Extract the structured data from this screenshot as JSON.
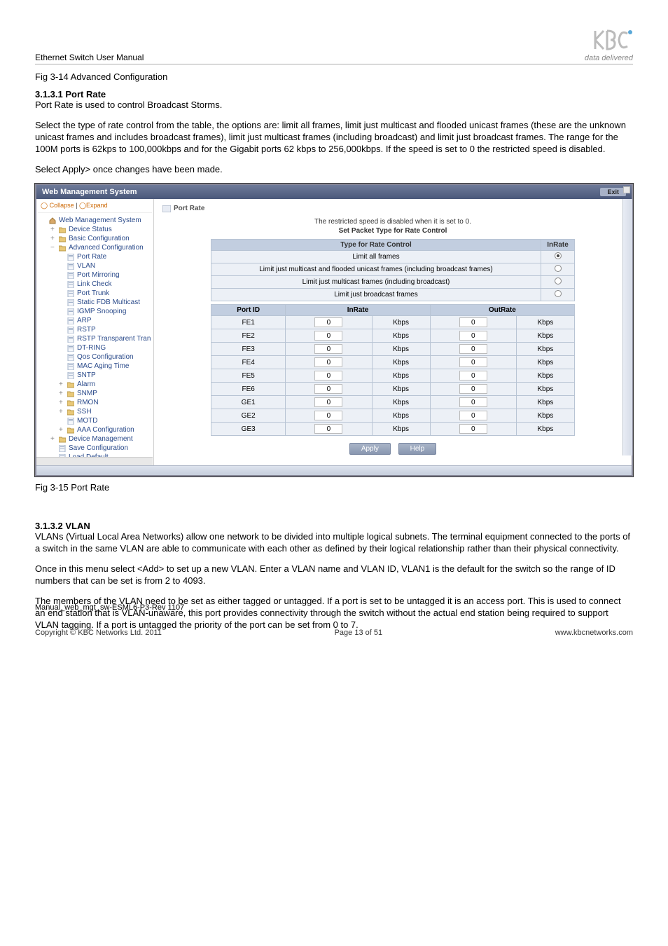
{
  "header": {
    "title": "Ethernet Switch User Manual",
    "logo_tagline": "data delivered"
  },
  "captions": {
    "fig_top": "Fig 3-14 Advanced Configuration",
    "fig_mid": "Fig 3-15 Port Rate"
  },
  "sections": {
    "s1_head": "3.1.3.1 Port Rate",
    "s1_p1": "Port Rate is used to control Broadcast Storms.",
    "s1_p2": "Select the type of rate control from the table, the options are: limit all frames, limit just multicast and flooded unicast frames (these are the unknown unicast frames and includes broadcast frames), limit just multicast frames (including broadcast) and limit just broadcast frames. The range for the 100M ports is 62kps to 100,000kbps and for the Gigabit ports 62 kbps to 256,000kbps. If the speed is set to 0 the restricted speed is disabled.",
    "s1_p3": "Select  Apply> once changes have been made.",
    "s2_head": "3.1.3.2 VLAN",
    "s2_p1": "VLANs (Virtual Local Area Networks) allow one network to be divided into multiple logical subnets. The terminal equipment connected to the ports of a switch in the same VLAN are able to communicate with each other as defined by their logical relationship rather than their physical connectivity.",
    "s2_p2": "Once in this menu select <Add> to set up a new VLAN. Enter a VLAN name and VLAN ID, VLAN1 is the default for the switch so the range of ID numbers that can be set is from 2 to 4093.",
    "s2_p3": "The members of the VLAN need to be set as either tagged or untagged. If a port is set to be untagged it is an access port. This is used to connect an end station that is VLAN-unaware, this port provides connectivity through the switch without the actual end station being required to support VLAN tagging. If a port is untagged the priority of the port can be set from 0 to 7."
  },
  "app": {
    "titlebar": "Web Management System",
    "exit": "Exit",
    "tree_collapse": "Collapse",
    "tree_expand": "Expand",
    "breadcrumb": "Port Rate",
    "tree": [
      {
        "label": "Web Management System",
        "level": 0,
        "icon": "home"
      },
      {
        "label": "Device Status",
        "level": 1,
        "icon": "folder"
      },
      {
        "label": "Basic Configuration",
        "level": 1,
        "icon": "folder"
      },
      {
        "label": "Advanced Configuration",
        "level": 1,
        "icon": "folder-open"
      },
      {
        "label": "Port Rate",
        "level": 2,
        "icon": "page"
      },
      {
        "label": "VLAN",
        "level": 2,
        "icon": "page"
      },
      {
        "label": "Port Mirroring",
        "level": 2,
        "icon": "page"
      },
      {
        "label": "Link Check",
        "level": 2,
        "icon": "page"
      },
      {
        "label": "Port Trunk",
        "level": 2,
        "icon": "page"
      },
      {
        "label": "Static FDB Multicast",
        "level": 2,
        "icon": "page"
      },
      {
        "label": "IGMP Snooping",
        "level": 2,
        "icon": "page"
      },
      {
        "label": "ARP",
        "level": 2,
        "icon": "page"
      },
      {
        "label": "RSTP",
        "level": 2,
        "icon": "page"
      },
      {
        "label": "RSTP Transparent Tran",
        "level": 2,
        "icon": "page"
      },
      {
        "label": "DT-RING",
        "level": 2,
        "icon": "page"
      },
      {
        "label": "Qos Configuration",
        "level": 2,
        "icon": "page"
      },
      {
        "label": "MAC Aging Time",
        "level": 2,
        "icon": "page"
      },
      {
        "label": "SNTP",
        "level": 2,
        "icon": "page"
      },
      {
        "label": "Alarm",
        "level": 2,
        "icon": "folder"
      },
      {
        "label": "SNMP",
        "level": 2,
        "icon": "folder"
      },
      {
        "label": "RMON",
        "level": 2,
        "icon": "folder"
      },
      {
        "label": "SSH",
        "level": 2,
        "icon": "folder"
      },
      {
        "label": "MOTD",
        "level": 2,
        "icon": "page"
      },
      {
        "label": "AAA Configuration",
        "level": 2,
        "icon": "folder"
      },
      {
        "label": "Device Management",
        "level": 1,
        "icon": "folder"
      },
      {
        "label": "Save Configuration",
        "level": 1,
        "icon": "page"
      },
      {
        "label": "Load Default",
        "level": 1,
        "icon": "page"
      }
    ],
    "restrict_line": "The restricted speed is disabled when it is set to 0.",
    "restrict_sub": "Set Packet Type for Rate Control",
    "type_table": {
      "h_type": "Type for Rate Control",
      "h_inrate": "InRate",
      "rows": [
        {
          "label": "Limit all frames",
          "sel": true
        },
        {
          "label": "Limit just multicast and flooded unicast frames (including broadcast frames)",
          "sel": false
        },
        {
          "label": "Limit just multicast frames (including broadcast)",
          "sel": false
        },
        {
          "label": "Limit just broadcast frames",
          "sel": false
        }
      ]
    },
    "port_table": {
      "h_port": "Port ID",
      "h_in": "InRate",
      "h_out": "OutRate",
      "unit": "Kbps",
      "rows": [
        {
          "port": "FE1",
          "in": "0",
          "out": "0"
        },
        {
          "port": "FE2",
          "in": "0",
          "out": "0"
        },
        {
          "port": "FE3",
          "in": "0",
          "out": "0"
        },
        {
          "port": "FE4",
          "in": "0",
          "out": "0"
        },
        {
          "port": "FE5",
          "in": "0",
          "out": "0"
        },
        {
          "port": "FE6",
          "in": "0",
          "out": "0"
        },
        {
          "port": "GE1",
          "in": "0",
          "out": "0"
        },
        {
          "port": "GE2",
          "in": "0",
          "out": "0"
        },
        {
          "port": "GE3",
          "in": "0",
          "out": "0"
        }
      ]
    },
    "btn_apply": "Apply",
    "btn_help": "Help"
  },
  "footer": {
    "manual_id": "Manual_web_mgt_sw-ESML6-P3-Rev 1107",
    "copyright": "Copyright © KBC Networks Ltd. 2011",
    "page": "Page 13 of 51",
    "url": "www.kbcnetworks.com"
  }
}
